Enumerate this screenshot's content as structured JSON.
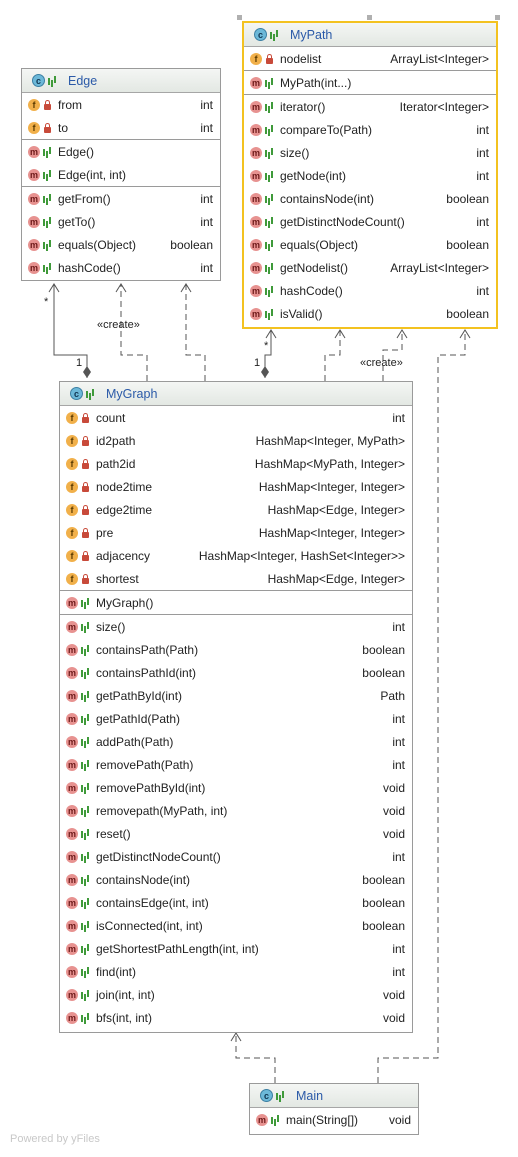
{
  "classes": {
    "edge": {
      "name": "Edge",
      "fields": [
        {
          "name": "from",
          "type": "int"
        },
        {
          "name": "to",
          "type": "int"
        }
      ],
      "constructors": [
        {
          "name": "Edge()",
          "type": ""
        },
        {
          "name": "Edge(int, int)",
          "type": ""
        }
      ],
      "methods": [
        {
          "name": "getFrom()",
          "type": "int"
        },
        {
          "name": "getTo()",
          "type": "int"
        },
        {
          "name": "equals(Object)",
          "type": "boolean"
        },
        {
          "name": "hashCode()",
          "type": "int"
        }
      ]
    },
    "mypath": {
      "name": "MyPath",
      "fields": [
        {
          "name": "nodelist",
          "type": "ArrayList<Integer>"
        }
      ],
      "constructors": [
        {
          "name": "MyPath(int...)",
          "type": ""
        }
      ],
      "methods": [
        {
          "name": "iterator()",
          "type": "Iterator<Integer>"
        },
        {
          "name": "compareTo(Path)",
          "type": "int"
        },
        {
          "name": "size()",
          "type": "int"
        },
        {
          "name": "getNode(int)",
          "type": "int"
        },
        {
          "name": "containsNode(int)",
          "type": "boolean"
        },
        {
          "name": "getDistinctNodeCount()",
          "type": "int"
        },
        {
          "name": "equals(Object)",
          "type": "boolean"
        },
        {
          "name": "getNodelist()",
          "type": "ArrayList<Integer>"
        },
        {
          "name": "hashCode()",
          "type": "int"
        },
        {
          "name": "isValid()",
          "type": "boolean"
        }
      ]
    },
    "mygraph": {
      "name": "MyGraph",
      "fields": [
        {
          "name": "count",
          "type": "int"
        },
        {
          "name": "id2path",
          "type": "HashMap<Integer, MyPath>"
        },
        {
          "name": "path2id",
          "type": "HashMap<MyPath, Integer>"
        },
        {
          "name": "node2time",
          "type": "HashMap<Integer, Integer>"
        },
        {
          "name": "edge2time",
          "type": "HashMap<Edge, Integer>"
        },
        {
          "name": "pre",
          "type": "HashMap<Integer, Integer>"
        },
        {
          "name": "adjacency",
          "type": "HashMap<Integer, HashSet<Integer>>"
        },
        {
          "name": "shortest",
          "type": "HashMap<Edge, Integer>"
        }
      ],
      "constructors": [
        {
          "name": "MyGraph()",
          "type": ""
        }
      ],
      "methods": [
        {
          "name": "size()",
          "type": "int"
        },
        {
          "name": "containsPath(Path)",
          "type": "boolean"
        },
        {
          "name": "containsPathId(int)",
          "type": "boolean"
        },
        {
          "name": "getPathById(int)",
          "type": "Path"
        },
        {
          "name": "getPathId(Path)",
          "type": "int"
        },
        {
          "name": "addPath(Path)",
          "type": "int"
        },
        {
          "name": "removePath(Path)",
          "type": "int"
        },
        {
          "name": "removePathById(int)",
          "type": "void"
        },
        {
          "name": "removepath(MyPath, int)",
          "type": "void"
        },
        {
          "name": "reset()",
          "type": "void"
        },
        {
          "name": "getDistinctNodeCount()",
          "type": "int"
        },
        {
          "name": "containsNode(int)",
          "type": "boolean"
        },
        {
          "name": "containsEdge(int, int)",
          "type": "boolean"
        },
        {
          "name": "isConnected(int, int)",
          "type": "boolean"
        },
        {
          "name": "getShortestPathLength(int, int)",
          "type": "int"
        },
        {
          "name": "find(int)",
          "type": "int"
        },
        {
          "name": "join(int, int)",
          "type": "void"
        },
        {
          "name": "bfs(int, int)",
          "type": "void"
        }
      ]
    },
    "main": {
      "name": "Main",
      "methods": [
        {
          "name": "main(String[])",
          "type": "void"
        }
      ]
    }
  },
  "labels": {
    "create_edge": "«create»",
    "create_mypath": "«create»",
    "mult_edge_star": "*",
    "mult_edge_one": "1",
    "mult_path_star": "*",
    "mult_path_one": "1"
  },
  "footer": "Powered by yFiles",
  "icons": {
    "class": "class-icon",
    "field": "field-icon",
    "method": "method-icon"
  },
  "colors": {
    "selection": "#f3c220",
    "class_name": "#2b5aa8",
    "field_icon": "#f1b04a",
    "method_icon": "#e79290",
    "class_icon": "#6cb8d8"
  }
}
